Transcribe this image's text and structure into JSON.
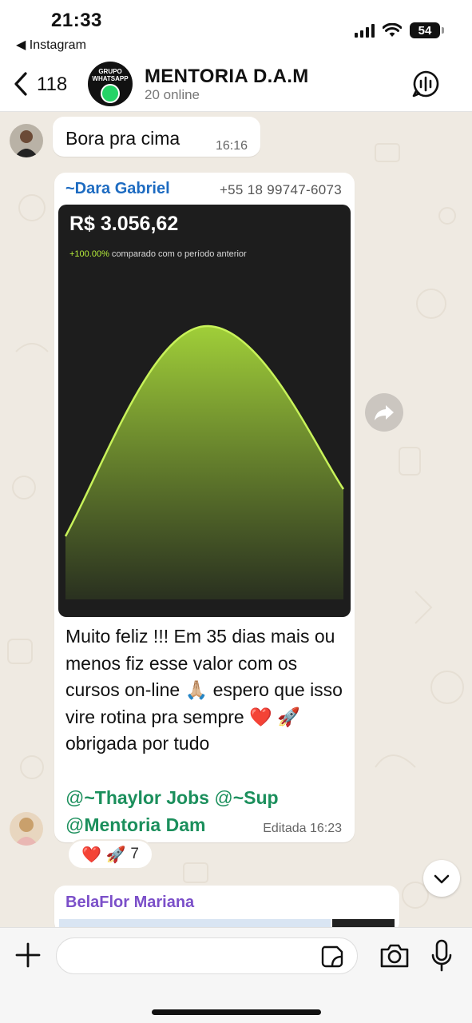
{
  "status_bar": {
    "time": "21:33",
    "back_app": "◀ Instagram",
    "battery": "54"
  },
  "header": {
    "unread_count": "118",
    "avatar_text": "GRUPO WHATSAPP",
    "group_name": "MENTORIA D.A.M",
    "group_status": "20 online"
  },
  "messages": [
    {
      "text": "Bora pra cima",
      "time": "16:16"
    },
    {
      "sender": "~Dara Gabriel",
      "phone": "+55 18 99747-6073",
      "image": {
        "amount": "R$ 3.056,62",
        "delta_pct": "+100.00%",
        "delta_text": "comparado com o período anterior"
      },
      "caption": "Muito feliz !!! Em 35 dias mais ou menos fiz esse valor com os cursos on-line 🙏🏼 espero que isso vire rotina pra sempre ❤️ 🚀 obrigada por tudo",
      "mentions": [
        {
          "at": "@",
          "name": "~Thaylor Jobs"
        },
        {
          "at": "@",
          "name": "~Sup"
        },
        {
          "at": "@",
          "name": "Mentoria Dam"
        }
      ],
      "edited_time": "Editada 16:23",
      "reactions": {
        "emojis": "❤️ 🚀",
        "count": "7"
      }
    },
    {
      "sender": "BelaFlor Mariana"
    }
  ],
  "input": {
    "placeholder": ""
  },
  "colors": {
    "chat_bg": "#efeae2",
    "sender_blue": "#1d6bc1",
    "mention_green": "#1b8f5c",
    "sender_purple": "#7b4fc9",
    "chart_lime": "#b7ef3a"
  }
}
